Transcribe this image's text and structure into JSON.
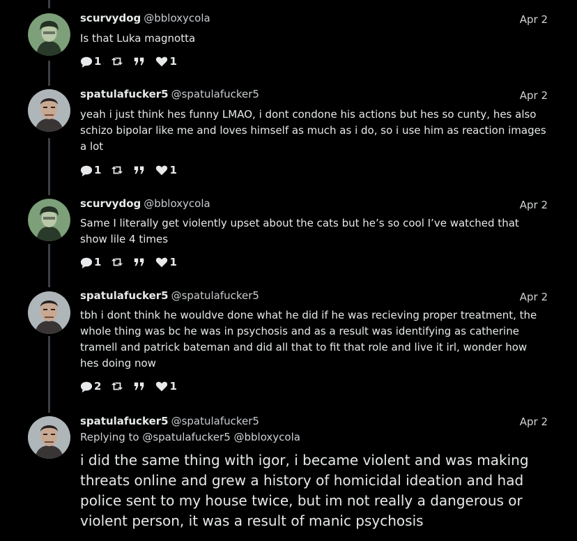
{
  "posts": [
    {
      "display_name": "scurvydog",
      "handle": "@bbloxycola",
      "date": "Apr 2",
      "text": "Is that Luka magnotta",
      "replies": "1",
      "likes": "1",
      "avatar": "green-helmet-avatar"
    },
    {
      "display_name": "spatulafucker5",
      "handle": "@spatulafucker5",
      "date": "Apr 2",
      "text": "yeah i just think hes funny LMAO, i dont condone his actions but hes so cunty, hes also schizo bipolar like me and loves himself as much as i do, so i use him as reaction images a lot",
      "replies": "1",
      "likes": "1",
      "avatar": "mugshot-avatar"
    },
    {
      "display_name": "scurvydog",
      "handle": "@bbloxycola",
      "date": "Apr 2",
      "text": "Same I literally get violently upset about the cats but he’s so cool I’ve watched that show lile 4 times",
      "replies": "1",
      "likes": "1",
      "avatar": "green-helmet-avatar"
    },
    {
      "display_name": "spatulafucker5",
      "handle": "@spatulafucker5",
      "date": "Apr 2",
      "text": "tbh i dont think he wouldve done what he did if he was recieving proper treatment, the whole thing was bc he was in psychosis and as a result was identifying as catherine tramell and patrick bateman and did all that to fit that role and live it irl, wonder how hes doing now",
      "replies": "2",
      "likes": "1",
      "avatar": "mugshot-avatar"
    }
  ],
  "main_post": {
    "display_name": "spatulafucker5",
    "handle": "@spatulafucker5",
    "date": "Apr 2",
    "replying_to": "Replying to @spatulafucker5 @bbloxycola",
    "text": "i did the same thing with igor, i became violent and was making threats online and grew a history of homicidal ideation and had police sent to my house twice, but im not really a dangerous or violent person, it was a result of manic psychosis",
    "avatar": "mugshot-avatar"
  },
  "icons": {
    "reply": "speech-bubble-icon",
    "repost": "repost-arrows-icon",
    "quote": "quote-icon",
    "like": "heart-icon"
  },
  "colors": {
    "background": "#000000",
    "text": "#e7e9ea",
    "thread_line": "#3a3f44"
  }
}
